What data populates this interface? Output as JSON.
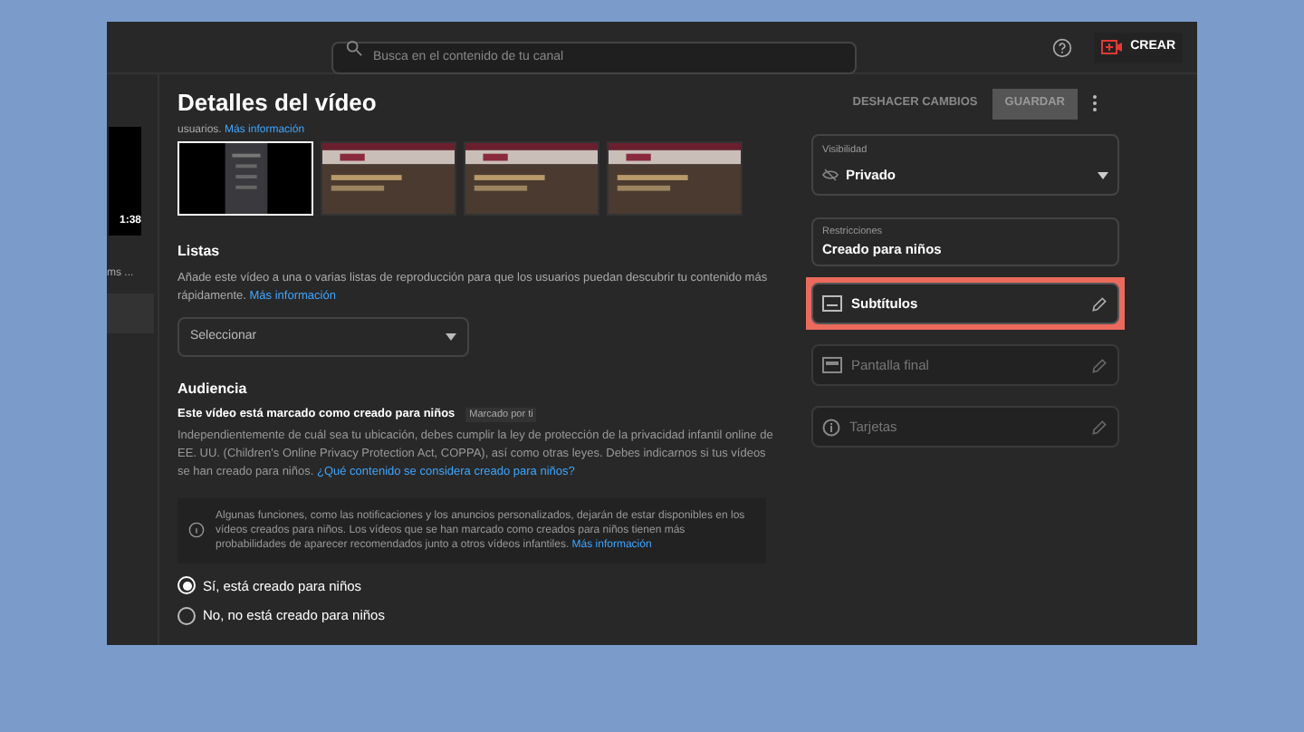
{
  "topbar": {
    "search_placeholder": "Busca en el contenido de tu canal",
    "create_label": "CREAR"
  },
  "sidebar": {
    "duration": "1:38",
    "title_fragment": "ms ..."
  },
  "header": {
    "title": "Detalles del vídeo",
    "undo": "DESHACER CAMBIOS",
    "save": "GUARDAR"
  },
  "thumbnails_note": {
    "text": "usuarios.",
    "link": "Más información"
  },
  "thumbnails": [
    {
      "selected": true
    },
    {
      "selected": false
    },
    {
      "selected": false
    },
    {
      "selected": false
    }
  ],
  "lists": {
    "heading": "Listas",
    "text": "Añade este vídeo a una o varias listas de reproducción para que los usuarios puedan descubrir tu contenido más rápidamente.",
    "link": "Más información",
    "select": "Seleccionar"
  },
  "audience": {
    "heading": "Audiencia",
    "status": "Este vídeo está marcado como creado para niños",
    "badge": "Marcado por ti",
    "text": "Independientemente de cuál sea tu ubicación, debes cumplir la ley de protección de la privacidad infantil online de EE. UU. (Children's Online Privacy Protection Act, COPPA), así como otras leyes. Debes indicarnos si tus vídeos se han creado para niños.",
    "link": "¿Qué contenido se considera creado para niños?",
    "info": "Algunas funciones, como las notificaciones y los anuncios personalizados, dejarán de estar disponibles en los vídeos creados para niños. Los vídeos que se han marcado como creados para niños tienen más probabilidades de aparecer recomendados junto a otros vídeos infantiles.",
    "info_link": "Más información",
    "options": [
      {
        "label": "Sí, está creado para niños",
        "selected": true
      },
      {
        "label": "No, no está creado para niños",
        "selected": false
      }
    ]
  },
  "visibility": {
    "label": "Visibilidad",
    "value": "Privado"
  },
  "restrictions": {
    "label": "Restricciones",
    "value": "Creado para niños"
  },
  "features": [
    {
      "kind": "subtitles",
      "label": "Subtítulos",
      "disabled": false,
      "highlighted": true
    },
    {
      "kind": "endscreen",
      "label": "Pantalla final",
      "disabled": true,
      "highlighted": false
    },
    {
      "kind": "cards",
      "label": "Tarjetas",
      "disabled": true,
      "highlighted": false
    }
  ]
}
